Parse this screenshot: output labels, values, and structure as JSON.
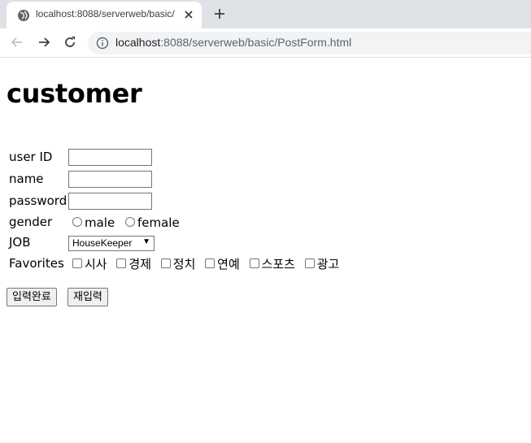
{
  "browser": {
    "tab_title": "localhost:8088/serverweb/basic/",
    "url_host": "localhost",
    "url_rest": ":8088/serverweb/basic/PostForm.html"
  },
  "page": {
    "heading": "customer",
    "form": {
      "userid_label": "user ID",
      "userid_value": "",
      "name_label": "name",
      "name_value": "",
      "password_label": "password",
      "password_value": "",
      "gender_label": "gender",
      "gender_options": [
        "male",
        "female"
      ],
      "job_label": "JOB",
      "job_selected": "HouseKeeper",
      "favorites_label": "Favorites",
      "favorites": [
        "시사",
        "경제",
        "정치",
        "연예",
        "스포츠",
        "광고"
      ],
      "submit_label": "입력완료",
      "reset_label": "재입력"
    }
  }
}
